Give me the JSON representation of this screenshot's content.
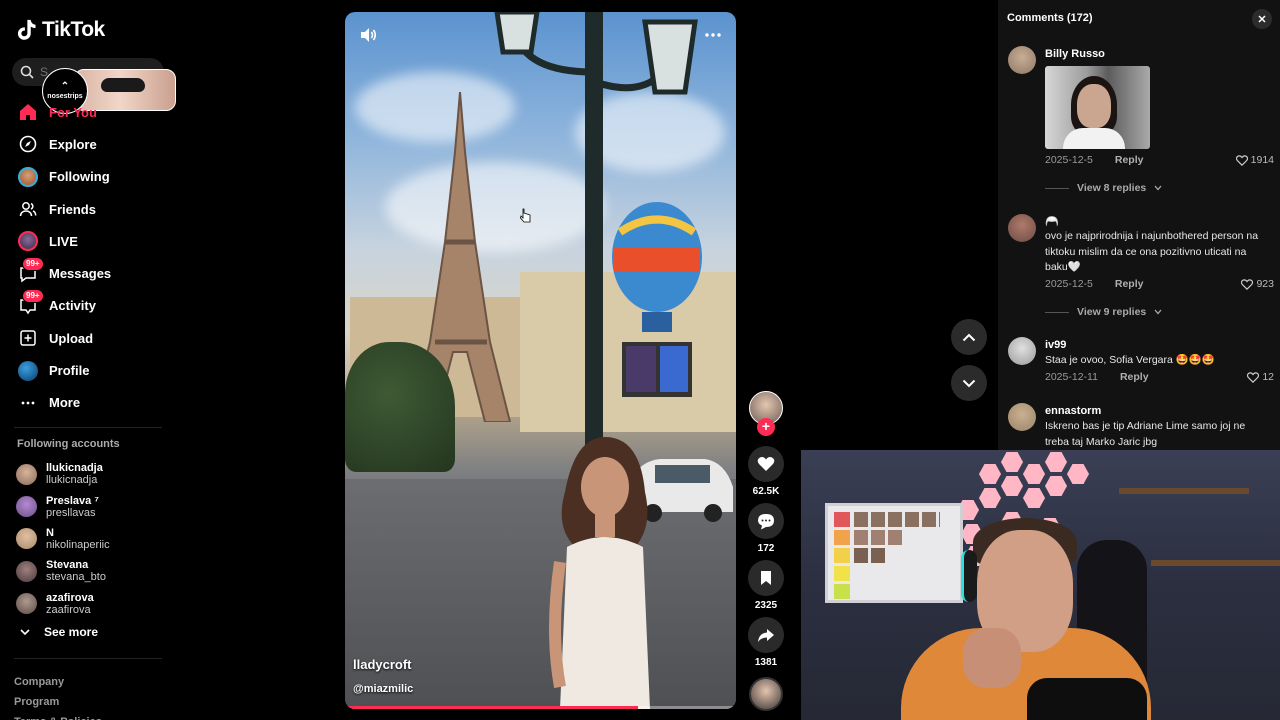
{
  "app": {
    "name": "TikTok"
  },
  "search": {
    "placeholder": "S"
  },
  "popup": {
    "label": "nosestrips"
  },
  "nav": {
    "items": [
      {
        "label": "For You"
      },
      {
        "label": "Explore"
      },
      {
        "label": "Following"
      },
      {
        "label": "Friends"
      },
      {
        "label": "LIVE"
      },
      {
        "label": "Messages",
        "badge": "99+"
      },
      {
        "label": "Activity",
        "badge": "99+"
      },
      {
        "label": "Upload"
      },
      {
        "label": "Profile"
      },
      {
        "label": "More"
      }
    ]
  },
  "following_accounts": {
    "title": "Following accounts",
    "items": [
      {
        "name": "llukicnadja",
        "handle": "llukicnadja",
        "color": "#8a6a5a"
      },
      {
        "name": "Preslava ⁷",
        "handle": "presllavas",
        "color": "#6b4f8a"
      },
      {
        "name": "N",
        "handle": "nikolinaperiic",
        "color": "#a88a6a"
      },
      {
        "name": "Stevana",
        "handle": "stevana_bto",
        "color": "#4a3a3a"
      },
      {
        "name": "azafirova",
        "handle": "zaafirova",
        "color": "#5a4a44"
      }
    ],
    "see_more": "See more"
  },
  "footer": {
    "links": [
      "Company",
      "Program",
      "Terms & Policies"
    ]
  },
  "video": {
    "author": "lladycroft",
    "handle": "@miazmilic",
    "progress": 0.75
  },
  "actions": {
    "likes": "62.5K",
    "comments": "172",
    "saves": "2325",
    "shares": "1381"
  },
  "comments_panel": {
    "header": "Comments (172)",
    "items": [
      {
        "name": "Billy Russo",
        "text": "",
        "date": "2025-12-5",
        "reply": "Reply",
        "likes": "1914",
        "view_replies": "View 8 replies",
        "avatar_color": "#8c7766"
      },
      {
        "name": "🦳",
        "text": "ovo je najprirodnija i najunbothered person na tiktoku mislim da ce ona pozitivno uticati na baku🤍",
        "date": "2025-12-5",
        "reply": "Reply",
        "likes": "923",
        "view_replies": "View 9 replies",
        "avatar_color": "#6a4b45"
      },
      {
        "name": "iv99",
        "text": "Staa je ovoo, Sofia Vergara 🤩🤩🤩",
        "date": "2025-12-11",
        "reply": "Reply",
        "likes": "12",
        "avatar_color": "#b9b9b9"
      },
      {
        "name": "ennastorm",
        "text": "Iskreno bas je tip Adriane Lime samo joj ne treba taj Marko Jaric jbg",
        "avatar_color": "#9a8468"
      }
    ]
  },
  "colors": {
    "accent": "#fe2c55",
    "panel": "#121212"
  }
}
